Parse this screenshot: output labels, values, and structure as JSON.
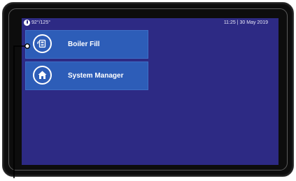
{
  "status_bar": {
    "temperature": "92°/125°",
    "datetime": "11:25 | 30 May 2019"
  },
  "menu": {
    "items": [
      {
        "label": "Boiler Fill",
        "icon": "boiler-fill-icon"
      },
      {
        "label": "System Manager",
        "icon": "home-icon"
      }
    ]
  },
  "colors": {
    "screen_background": "#2d2a84",
    "button_background": "#2d5db8",
    "bezel": "#0d0d0d"
  }
}
